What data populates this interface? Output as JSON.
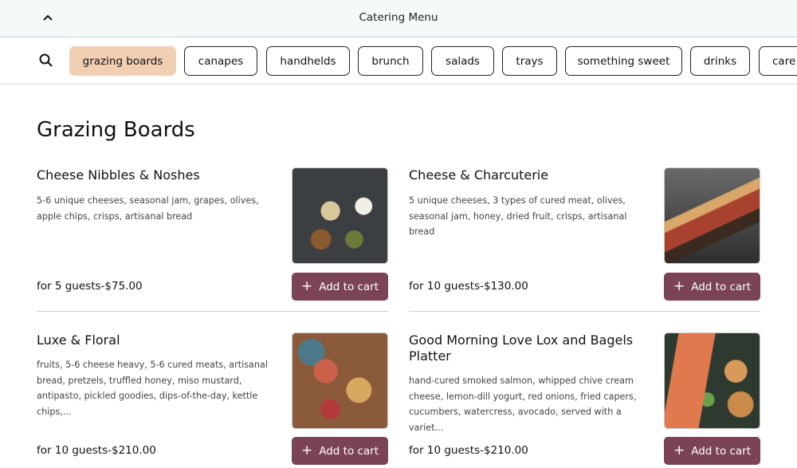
{
  "header": {
    "title": "Catering Menu",
    "back_icon": "chevron-up-icon"
  },
  "categories": [
    {
      "label": "grazing boards",
      "active": true
    },
    {
      "label": "canapes"
    },
    {
      "label": "handhelds"
    },
    {
      "label": "brunch"
    },
    {
      "label": "salads"
    },
    {
      "label": "trays"
    },
    {
      "label": "something sweet"
    },
    {
      "label": "drinks"
    },
    {
      "label": "care"
    }
  ],
  "section_title": "Grazing Boards",
  "add_label": "Add to cart",
  "items": [
    {
      "name": "Cheese Nibbles & Noshes",
      "description": "5-6 unique cheeses, seasonal jam, grapes, olives, apple chips, crisps, artisanal bread",
      "price": "for 5 guests-$75.00"
    },
    {
      "name": "Cheese & Charcuterie",
      "description": "5 unique cheeses, 3 types of cured meat, olives, seasonal jam, honey, dried fruit, crisps, artisanal bread",
      "price": "for 10 guests-$130.00"
    },
    {
      "name": "Luxe & Floral",
      "description": "fruits, 5-6 cheese heavy, 5-6 cured meats, artisanal bread, pretzels, truffled honey, miso mustard, antipasto, pickled goodies, dips-of-the-day, kettle chips,...",
      "price": "for 10 guests-$210.00"
    },
    {
      "name": "Good Morning Love Lox and Bagels Platter",
      "description": "hand-cured smoked salmon, whipped chive cream cheese, lemon-dill yogurt, red onions, fried capers, cucumbers, watercress, avocado, served with a variet...",
      "price": "for 10 guests-$210.00"
    }
  ],
  "colors": {
    "accent": "#7a4356",
    "active_chip": "#f0cfb2",
    "header_bg": "#f4f9fa"
  }
}
